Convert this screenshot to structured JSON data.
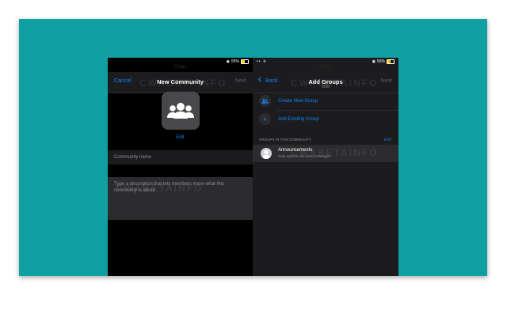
{
  "left_screen": {
    "status": {
      "battery": "55%"
    },
    "ghost_title": "Chats",
    "nav": {
      "cancel": "Cancel",
      "title": "New Community",
      "next": "Next"
    },
    "edit_label": "Edit",
    "name_placeholder": "Community name",
    "description_placeholder": "Type a description that lets members know what this community is about"
  },
  "right_screen": {
    "status": {
      "signal": "•• ✈",
      "battery": "55%"
    },
    "ghost_title": "Chats",
    "nav": {
      "back": "Back",
      "title": "Add Groups",
      "subtitle": "1/50",
      "next": "Next"
    },
    "actions": [
      {
        "label": "Create New Group",
        "icon": "people-icon"
      },
      {
        "label": "Add Existing Group",
        "icon": "plus-icon"
      }
    ],
    "section": {
      "title": "GROUPS IN THIS COMMUNITY",
      "edit": "EDIT"
    },
    "group": {
      "name": "Announcements",
      "desc": "Only admins can send messages"
    }
  },
  "watermark": "CWABETAINFO",
  "colors": {
    "background": "#109fa2",
    "accent": "#0a84ff",
    "panel": "#1c1c1e"
  }
}
